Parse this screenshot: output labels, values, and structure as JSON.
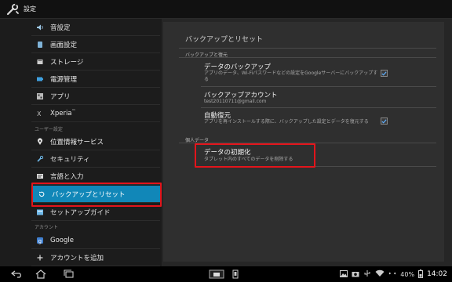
{
  "app": {
    "title": "設定",
    "icon": "wrench-icon"
  },
  "sidebar": {
    "items": [
      {
        "label": "音設定",
        "icon": "speaker-icon"
      },
      {
        "label": "画面設定",
        "icon": "tablet-icon"
      },
      {
        "label": "ストレージ",
        "icon": "storage-icon"
      },
      {
        "label": "電源管理",
        "icon": "battery-icon"
      },
      {
        "label": "アプリ",
        "icon": "apps-icon"
      },
      {
        "label": "Xperia",
        "suffix": "™",
        "icon": "xperia-icon"
      },
      {
        "label": "位置情報サービス",
        "icon": "location-icon"
      },
      {
        "label": "セキュリティ",
        "icon": "lock-icon"
      },
      {
        "label": "言語と入力",
        "icon": "language-icon"
      },
      {
        "label": "バックアップとリセット",
        "icon": "reset-icon"
      },
      {
        "label": "セットアップガイド",
        "icon": "guide-icon"
      },
      {
        "label": "Google",
        "icon": "google-icon"
      },
      {
        "label": "アカウントを追加",
        "icon": "plus-icon"
      }
    ],
    "sections": {
      "user": "ユーザー設定",
      "account": "アカウント"
    },
    "selected_color": "#1187b8"
  },
  "detail": {
    "title": "バックアップとリセット",
    "section_backup": "バックアップと復元",
    "backup_data": {
      "title": "データのバックアップ",
      "summary": "アプリのデータ、Wi-Fiパスワードなどの設定をGoogleサーバーにバックアップする",
      "checked": true
    },
    "backup_account": {
      "title": "バックアップアカウント",
      "value": "test20110711@gmail.com"
    },
    "auto_restore": {
      "title": "自動復元",
      "summary": "アプリを再インストールする際に、バックアップした設定とデータを復元する",
      "checked": true
    },
    "section_personal": "個人データ",
    "factory_reset": {
      "title": "データの初期化",
      "summary": "タブレット内のすべてのデータを削除する"
    }
  },
  "statusbar": {
    "battery": "40%",
    "time": "14:02"
  },
  "highlight_color": "#e3141b"
}
